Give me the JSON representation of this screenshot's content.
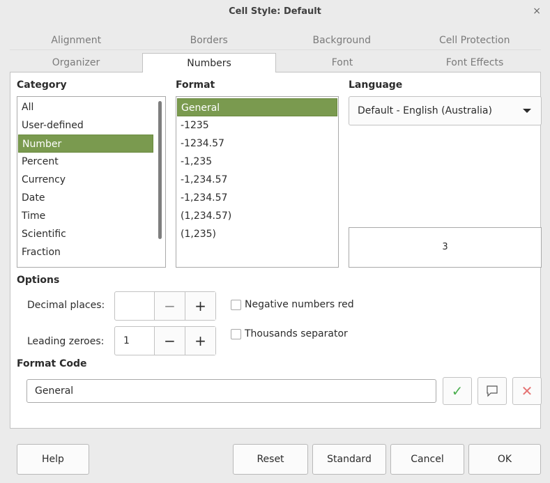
{
  "window": {
    "title": "Cell Style: Default",
    "close_glyph": "×"
  },
  "tabs_row1": [
    "Alignment",
    "Borders",
    "Background",
    "Cell Protection"
  ],
  "tabs_row2": [
    "Organizer",
    "Numbers",
    "Font",
    "Font Effects"
  ],
  "active_tab": "Numbers",
  "category": {
    "heading": "Category",
    "items": [
      "All",
      "User-defined",
      "Number",
      "Percent",
      "Currency",
      "Date",
      "Time",
      "Scientific",
      "Fraction"
    ],
    "selected": "Number"
  },
  "format": {
    "heading": "Format",
    "items": [
      "General",
      "-1235",
      "-1234.57",
      "-1,235",
      "-1,234.57",
      "-1,234.57",
      "(1,234.57)",
      "(1,235)"
    ],
    "selected": "General"
  },
  "language": {
    "heading": "Language",
    "selected": "Default - English (Australia)",
    "preview": "3"
  },
  "options": {
    "heading": "Options",
    "decimal_places_label": "Decimal places:",
    "decimal_places_value": "",
    "leading_zeroes_label": "Leading zeroes:",
    "leading_zeroes_value": "1",
    "minus": "−",
    "plus": "+",
    "negative_red_label": "Negative numbers red",
    "negative_red_checked": false,
    "thousands_label": "Thousands separator",
    "thousands_checked": false
  },
  "format_code": {
    "heading": "Format Code",
    "value": "General",
    "accept_glyph": "✓",
    "comment_icon": "comment-icon",
    "delete_glyph": "✕"
  },
  "buttons": {
    "help": "Help",
    "reset": "Reset",
    "standard": "Standard",
    "cancel": "Cancel",
    "ok": "OK"
  },
  "colors": {
    "selection": "#7a9a4f",
    "accept_green": "#4caf50",
    "delete_red": "#e57373"
  }
}
